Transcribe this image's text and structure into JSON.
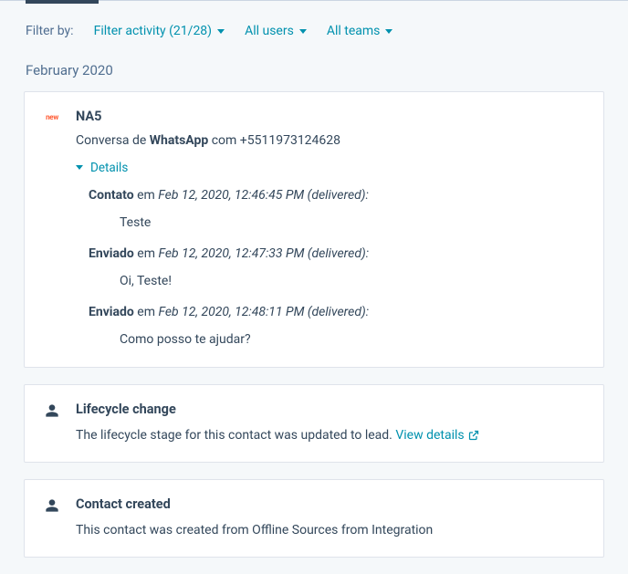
{
  "filter": {
    "label": "Filter by:",
    "activity": "Filter activity (21/28)",
    "users": "All users",
    "teams": "All teams"
  },
  "month_header": "February 2020",
  "conversation": {
    "logo_text": "new",
    "sender": "NA5",
    "sub_prefix": "Conversa de ",
    "sub_channel": "WhatsApp",
    "sub_mid": " com ",
    "sub_number": "+5511973124628",
    "details_label": "Details",
    "messages": [
      {
        "label": "Contato",
        "mid": " em ",
        "ts": "Feb 12, 2020, 12:46:45 PM",
        "status_open": " (",
        "status": "delivered",
        "status_close": "):",
        "body": "Teste"
      },
      {
        "label": "Enviado",
        "mid": " em ",
        "ts": "Feb 12, 2020, 12:47:33 PM",
        "status_open": " (",
        "status": "delivered",
        "status_close": "):",
        "body": "Oi, Teste!"
      },
      {
        "label": "Enviado",
        "mid": " em ",
        "ts": "Feb 12, 2020, 12:48:11 PM",
        "status_open": " (",
        "status": "delivered",
        "status_close": "):",
        "body": "Como posso te ajudar?"
      }
    ]
  },
  "lifecycle": {
    "title": "Lifecycle change",
    "text": "The lifecycle stage for this contact was updated to lead. ",
    "link": "View details"
  },
  "created": {
    "title": "Contact created",
    "text": "This contact was created from Offline Sources from Integration"
  }
}
